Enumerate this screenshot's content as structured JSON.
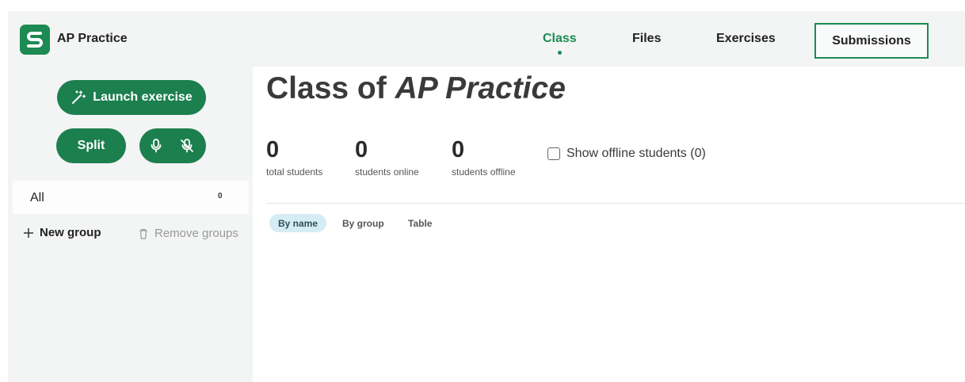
{
  "app": {
    "title": "AP Practice",
    "logo_letter": "S",
    "brand_color": "#1c8a52"
  },
  "nav": {
    "items": [
      {
        "label": "Class",
        "active": true
      },
      {
        "label": "Files",
        "active": false
      },
      {
        "label": "Exercises",
        "active": false
      }
    ],
    "submissions_label": "Submissions"
  },
  "sidebar": {
    "launch_label": "Launch exercise",
    "split_label": "Split",
    "groups": [
      {
        "label": "All",
        "count": "0"
      }
    ],
    "new_group_label": "New group",
    "remove_groups_label": "Remove groups"
  },
  "main": {
    "title_prefix": "Class of",
    "title_name": "AP Practice",
    "stats": [
      {
        "value": "0",
        "label": "total students"
      },
      {
        "value": "0",
        "label": "students online"
      },
      {
        "value": "0",
        "label": "students offline"
      }
    ],
    "offline_toggle_label": "Show offline students (0)",
    "view_options": [
      {
        "label": "By name",
        "active": true
      },
      {
        "label": "By group",
        "active": false
      },
      {
        "label": "Table",
        "active": false
      }
    ]
  },
  "icons": [
    "wand-icon",
    "mic-icon",
    "mic-off-icon",
    "plus-icon",
    "trash-icon"
  ]
}
